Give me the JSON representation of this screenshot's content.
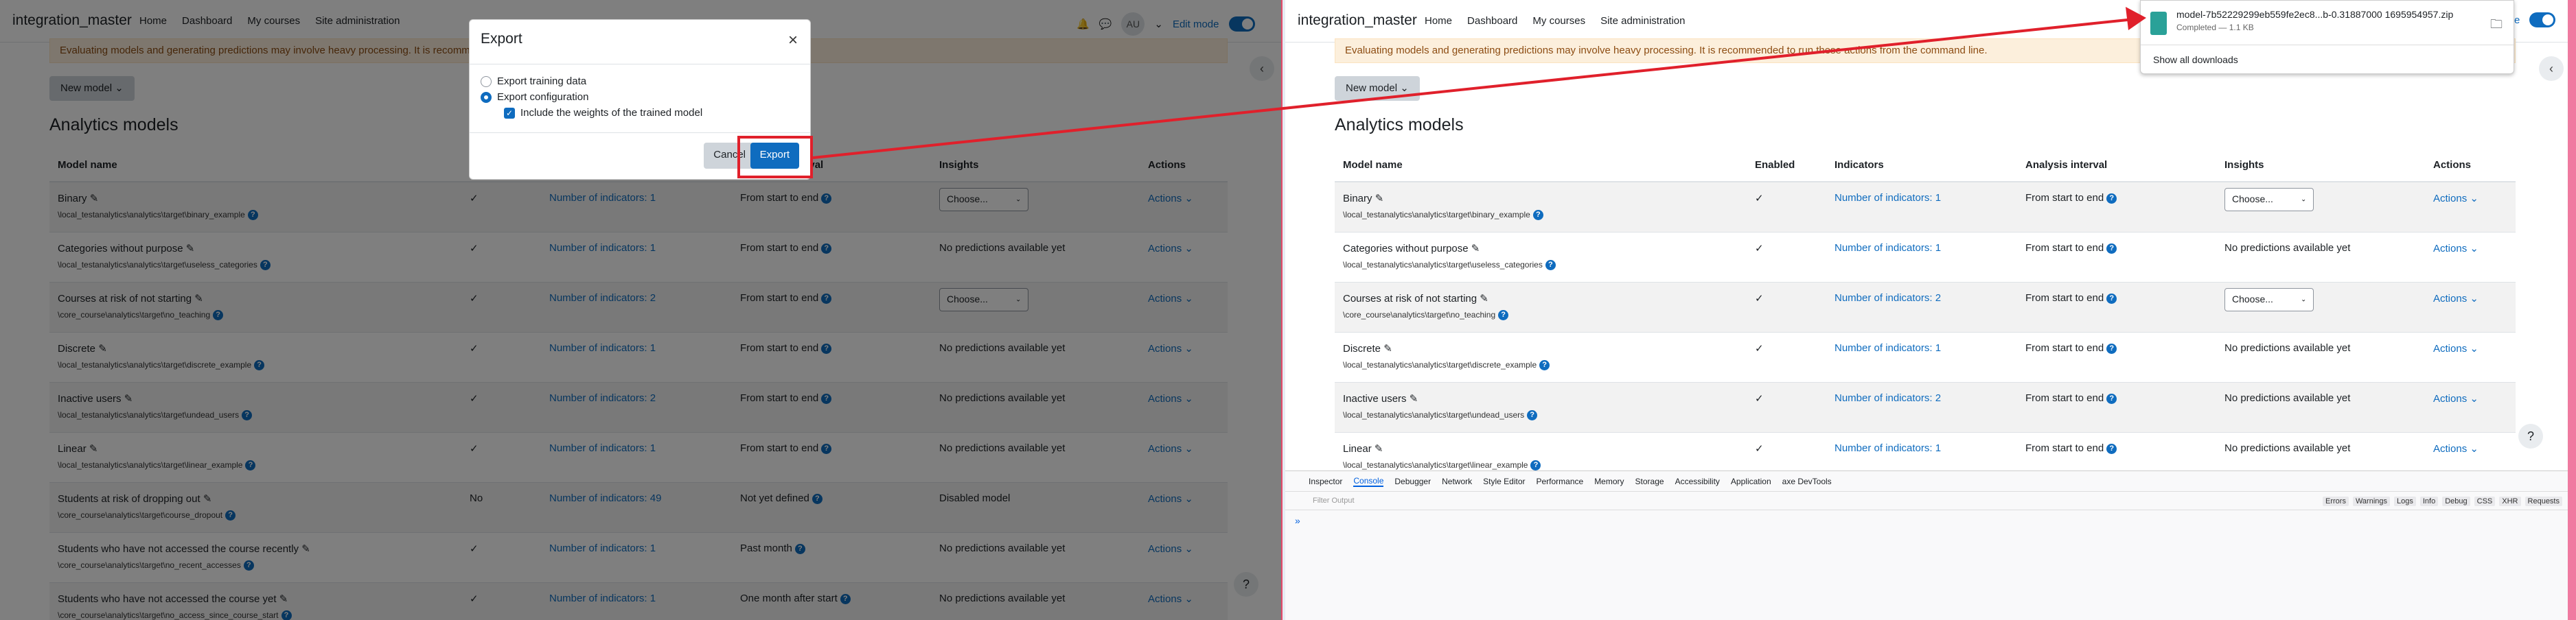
{
  "site": {
    "brand": "integration_master",
    "nav": [
      "Home",
      "Dashboard",
      "My courses",
      "Site administration"
    ],
    "avatar": "AU",
    "edit_mode": "Edit mode"
  },
  "banner": "Evaluating models and generating predictions may involve heavy processing. It is recommended to run these actions from the command line.",
  "new_model": "New model",
  "page_title": "Analytics models",
  "columns": [
    "Model name",
    "Enabled",
    "Indicators",
    "Analysis interval",
    "Insights",
    "Actions"
  ],
  "models": [
    {
      "name": "Binary",
      "target": "\\local_testanalytics\\analytics\\target\\binary_example",
      "enabled": "✓",
      "indicators": "Number of indicators: 1",
      "interval": "From start to end",
      "insights": "Choose...",
      "insights_select": true
    },
    {
      "name": "Categories without purpose",
      "target": "\\local_testanalytics\\analytics\\target\\useless_categories",
      "enabled": "✓",
      "indicators": "Number of indicators: 1",
      "interval": "From start to end",
      "insights": "No predictions available yet",
      "insights_select": false
    },
    {
      "name": "Courses at risk of not starting",
      "target": "\\core_course\\analytics\\target\\no_teaching",
      "enabled": "✓",
      "indicators": "Number of indicators: 2",
      "interval": "From start to end",
      "insights": "Choose...",
      "insights_select": true
    },
    {
      "name": "Discrete",
      "target": "\\local_testanalytics\\analytics\\target\\discrete_example",
      "enabled": "✓",
      "indicators": "Number of indicators: 1",
      "interval": "From start to end",
      "insights": "No predictions available yet",
      "insights_select": false
    },
    {
      "name": "Inactive users",
      "target": "\\local_testanalytics\\analytics\\target\\undead_users",
      "enabled": "✓",
      "indicators": "Number of indicators: 2",
      "interval": "From start to end",
      "insights": "No predictions available yet",
      "insights_select": false
    },
    {
      "name": "Linear",
      "target": "\\local_testanalytics\\analytics\\target\\linear_example",
      "enabled": "✓",
      "indicators": "Number of indicators: 1",
      "interval": "From start to end",
      "insights": "No predictions available yet",
      "insights_select": false
    },
    {
      "name": "Students at risk of dropping out",
      "target": "\\core_course\\analytics\\target\\course_dropout",
      "enabled": "No",
      "indicators": "Number of indicators: 49",
      "interval": "Not yet defined",
      "insights": "Disabled model",
      "insights_select": false
    },
    {
      "name": "Students who have not accessed the course recently",
      "target": "\\core_course\\analytics\\target\\no_recent_accesses",
      "enabled": "✓",
      "indicators": "Number of indicators: 1",
      "interval": "Past month",
      "insights": "No predictions available yet",
      "insights_select": false
    },
    {
      "name": "Students who have not accessed the course yet",
      "target": "\\core_course\\analytics\\target\\no_access_since_course_start",
      "enabled": "✓",
      "indicators": "Number of indicators: 1",
      "interval": "One month after start",
      "insights": "No predictions available yet",
      "insights_select": false
    }
  ],
  "actions_label": "Actions",
  "modal": {
    "title": "Export",
    "opt_training": "Export training data",
    "opt_config": "Export configuration",
    "opt_weights": "Include the weights of the trained model",
    "cancel": "Cancel",
    "export": "Export"
  },
  "download": {
    "filename": "model-7b52229299eb559fe2ec8...b-0.31887000 1695954957.zip",
    "status": "Completed — 1.1 KB",
    "show_all": "Show all downloads"
  },
  "devtools": {
    "tabs": [
      "Inspector",
      "Console",
      "Debugger",
      "Network",
      "Style Editor",
      "Performance",
      "Memory",
      "Storage",
      "Accessibility",
      "Application",
      "axe DevTools"
    ],
    "filter_placeholder": "Filter Output",
    "levels": [
      "Errors",
      "Warnings",
      "Logs",
      "Info",
      "Debug",
      "CSS",
      "XHR",
      "Requests"
    ],
    "prompt": "»"
  },
  "colors": {
    "accent": "#0f6cbf",
    "warning_bg": "#fcefdc",
    "arrow": "#e0202b"
  }
}
